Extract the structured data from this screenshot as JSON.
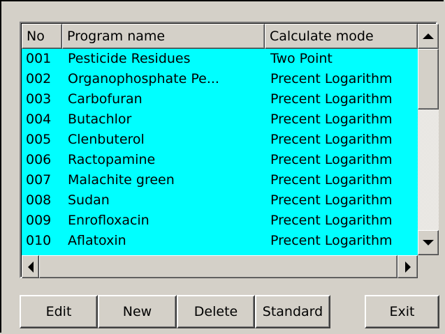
{
  "table": {
    "columns": [
      "No",
      "Program name",
      "Calculate mode"
    ],
    "rows": [
      [
        "001",
        "Pesticide Residues",
        "Two Point"
      ],
      [
        "002",
        "Organophosphate Pe...",
        "Precent Logarithm"
      ],
      [
        "003",
        "Carbofuran",
        "Precent Logarithm"
      ],
      [
        "004",
        "Butachlor",
        "Precent Logarithm"
      ],
      [
        "005",
        "Clenbuterol",
        "Precent Logarithm"
      ],
      [
        "006",
        "Ractopamine",
        "Precent Logarithm"
      ],
      [
        "007",
        "Malachite green",
        "Precent Logarithm"
      ],
      [
        "008",
        "Sudan",
        "Precent Logarithm"
      ],
      [
        "009",
        "Enrofloxacin",
        "Precent Logarithm"
      ],
      [
        "010",
        "Aflatoxin",
        "Precent Logarithm"
      ]
    ]
  },
  "buttons": {
    "edit": "Edit",
    "new": "New",
    "delete": "Delete",
    "standard": "Standard",
    "exit": "Exit"
  },
  "colors": {
    "list_background": "#00ffff",
    "face": "#d4d0c8"
  }
}
